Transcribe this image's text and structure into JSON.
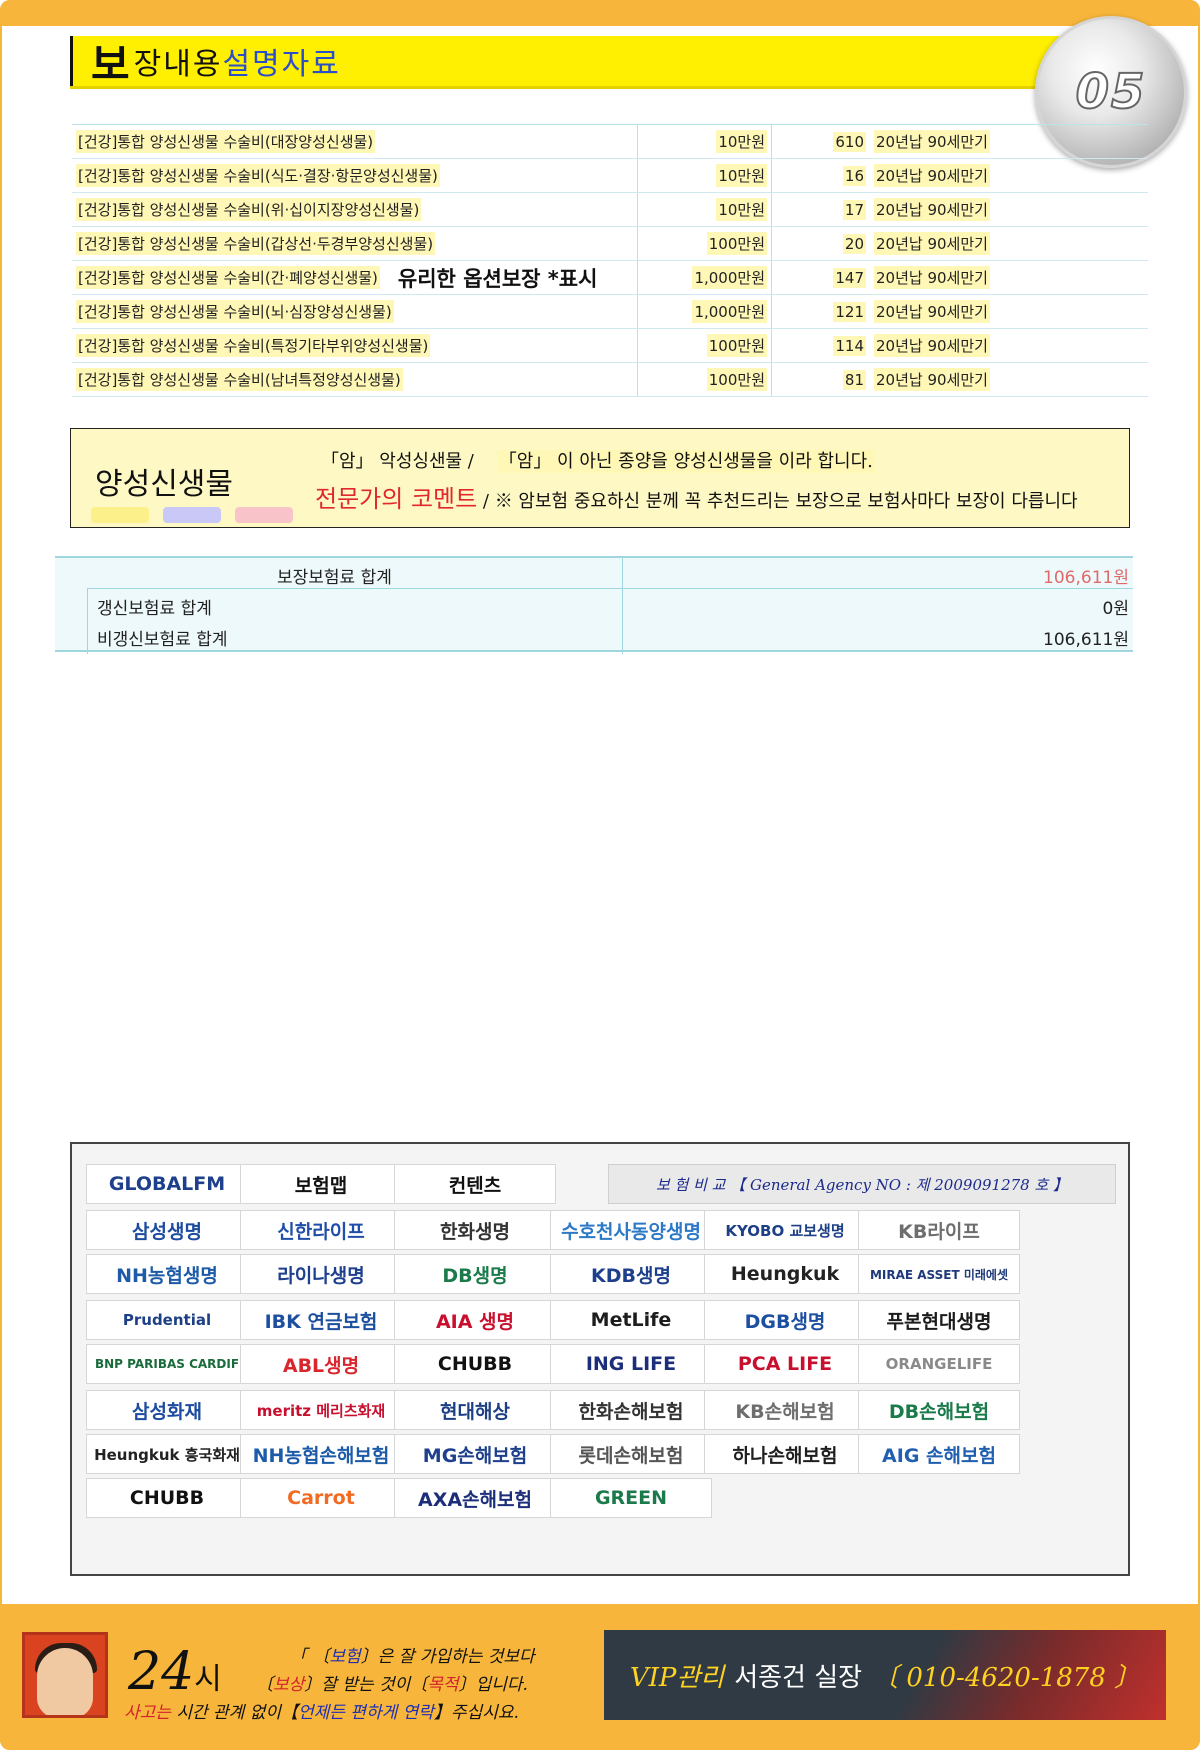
{
  "header": {
    "title_first": "보",
    "title_mid": "장내용",
    "title_end": "설명자료",
    "page_number": "05"
  },
  "coverage_rows": [
    {
      "name": "[건강]통합 양성신생물 수술비(대장양성신생물)",
      "amount": "10만원",
      "premium": "610",
      "term": "20년납 90세만기",
      "note": ""
    },
    {
      "name": "[건강]통합 양성신생물 수술비(식도·결장·항문양성신생물)",
      "amount": "10만원",
      "premium": "16",
      "term": "20년납 90세만기",
      "note": ""
    },
    {
      "name": "[건강]통합 양성신생물 수술비(위·십이지장양성신생물)",
      "amount": "10만원",
      "premium": "17",
      "term": "20년납 90세만기",
      "note": ""
    },
    {
      "name": "[건강]통합 양성신생물 수술비(갑상선·두경부양성신생물)",
      "amount": "100만원",
      "premium": "20",
      "term": "20년납 90세만기",
      "note": ""
    },
    {
      "name": "[건강]통합 양성신생물 수술비(간·폐양성신생물)",
      "amount": "1,000만원",
      "premium": "147",
      "term": "20년납 90세만기",
      "note": "유리한 옵션보장 *표시"
    },
    {
      "name": "[건강]통합 양성신생물 수술비(뇌·심장양성신생물)",
      "amount": "1,000만원",
      "premium": "121",
      "term": "20년납 90세만기",
      "note": ""
    },
    {
      "name": "[건강]통합 양성신생물 수술비(특정기타부위양성신생물)",
      "amount": "100만원",
      "premium": "114",
      "term": "20년납 90세만기",
      "note": ""
    },
    {
      "name": "[건강]통합 양성신생물 수술비(남녀특정양성신생물)",
      "amount": "100만원",
      "premium": "81",
      "term": "20년납 90세만기",
      "note": ""
    }
  ],
  "definition": {
    "title": "양성신생물",
    "line1_a": "「암」 악성싱샌물 /",
    "line1_b": "「암」 이 아닌 종양을 양성신생물을 이라 합니다.",
    "comment": "전문가의 코멘트",
    "line2": " / ※ 암보험 중요하신 분께 꼭 추천드리는 보장으로 보험사마다 보장이 다릅니다",
    "chip_colors": [
      "#fbf08a",
      "#c9c8f6",
      "#f9c4c9"
    ]
  },
  "totals": {
    "total_label": "보장보험료 합계",
    "total_value": "106,611원",
    "renewal_label": "갱신보험료 합계",
    "renewal_value": "0원",
    "nonrenewal_label": "비갱신보험료 합계",
    "nonrenewal_value": "106,611원"
  },
  "agency": "보 험 비 교 【 General Agency  NO : 제 2009091278 호 】",
  "insurers": [
    {
      "name": "GLOBALFM",
      "color": "#1d3f8c"
    },
    {
      "name": "보험맵",
      "color": "#111111"
    },
    {
      "name": "컨텐츠",
      "color": "#111111"
    },
    {
      "name": "삼성생명",
      "color": "#1c4ba0"
    },
    {
      "name": "신한라이프",
      "color": "#1f4fa8"
    },
    {
      "name": "한화생명",
      "color": "#333333"
    },
    {
      "name": "수호천사동양생명",
      "color": "#2d79c7"
    },
    {
      "name": "KYOBO 교보생명",
      "color": "#1c3f85"
    },
    {
      "name": "KB라이프",
      "color": "#6e6e6e"
    },
    {
      "name": "NH농협생명",
      "color": "#1d5ba8"
    },
    {
      "name": "라이나생명",
      "color": "#1d3f8c"
    },
    {
      "name": "DB생명",
      "color": "#1a7a4a"
    },
    {
      "name": "KDB생명",
      "color": "#1d3f8c"
    },
    {
      "name": "Heungkuk",
      "color": "#222222"
    },
    {
      "name": "MIRAE ASSET 미래에셋",
      "color": "#1f3a7a"
    },
    {
      "name": "Prudential",
      "color": "#1c3f85"
    },
    {
      "name": "IBK 연금보험",
      "color": "#1d4fa0"
    },
    {
      "name": "AIA 생명",
      "color": "#c8102e"
    },
    {
      "name": "MetLife",
      "color": "#1d1d1d"
    },
    {
      "name": "DGB생명",
      "color": "#1d4fa0"
    },
    {
      "name": "푸본현대생명",
      "color": "#1b1b1b"
    },
    {
      "name": "BNP PARIBAS CARDIF",
      "color": "#1a6b3c"
    },
    {
      "name": "ABL생명",
      "color": "#d8262e"
    },
    {
      "name": "CHUBB",
      "color": "#111111"
    },
    {
      "name": "ING LIFE",
      "color": "#1c2d7a"
    },
    {
      "name": "PCA LIFE",
      "color": "#c8102e"
    },
    {
      "name": "ORANGELIFE",
      "color": "#8a8a8a"
    },
    {
      "name": "삼성화재",
      "color": "#1c4ba0"
    },
    {
      "name": "meritz 메리츠화재",
      "color": "#c8102e"
    },
    {
      "name": "현대해상",
      "color": "#1c3f85"
    },
    {
      "name": "한화손해보험",
      "color": "#333333"
    },
    {
      "name": "KB손해보험",
      "color": "#6e6e6e"
    },
    {
      "name": "DB손해보험",
      "color": "#1a7a4a"
    },
    {
      "name": "Heungkuk 흥국화재",
      "color": "#222222"
    },
    {
      "name": "NH농협손해보험",
      "color": "#1d5ba8"
    },
    {
      "name": "MG손해보험",
      "color": "#1d3f8c"
    },
    {
      "name": "롯데손해보험",
      "color": "#555555"
    },
    {
      "name": "하나손해보험",
      "color": "#1f1f1f"
    },
    {
      "name": "AIG 손해보험",
      "color": "#1f5fb0"
    },
    {
      "name": "CHUBB",
      "color": "#111111"
    },
    {
      "name": "Carrot",
      "color": "#f26b22"
    },
    {
      "name": "AXA손해보험",
      "color": "#1c2d7a"
    },
    {
      "name": "GREEN",
      "color": "#1a7a4a"
    }
  ],
  "footer": {
    "hours": "24",
    "hours_unit": "시",
    "slogan1_a": "「 〔",
    "slogan1_b": "보험",
    "slogan1_c": "〕은 잘 가입하는 것보다",
    "slogan2_a": "〔",
    "slogan2_b": "보상",
    "slogan2_c": "〕잘 받는 것이〔",
    "slogan2_d": "목적",
    "slogan2_e": "〕입니다.",
    "slogan3_a": "사고는",
    "slogan3_b": " 시간 관계 없이【",
    "slogan3_c": "언제든 편하게 연락",
    "slogan3_d": "】주십시요.",
    "vip_label": "VIP관리",
    "vip_name": "서종건 실장",
    "vip_phone": "〔 010-4620-1878 〕"
  }
}
